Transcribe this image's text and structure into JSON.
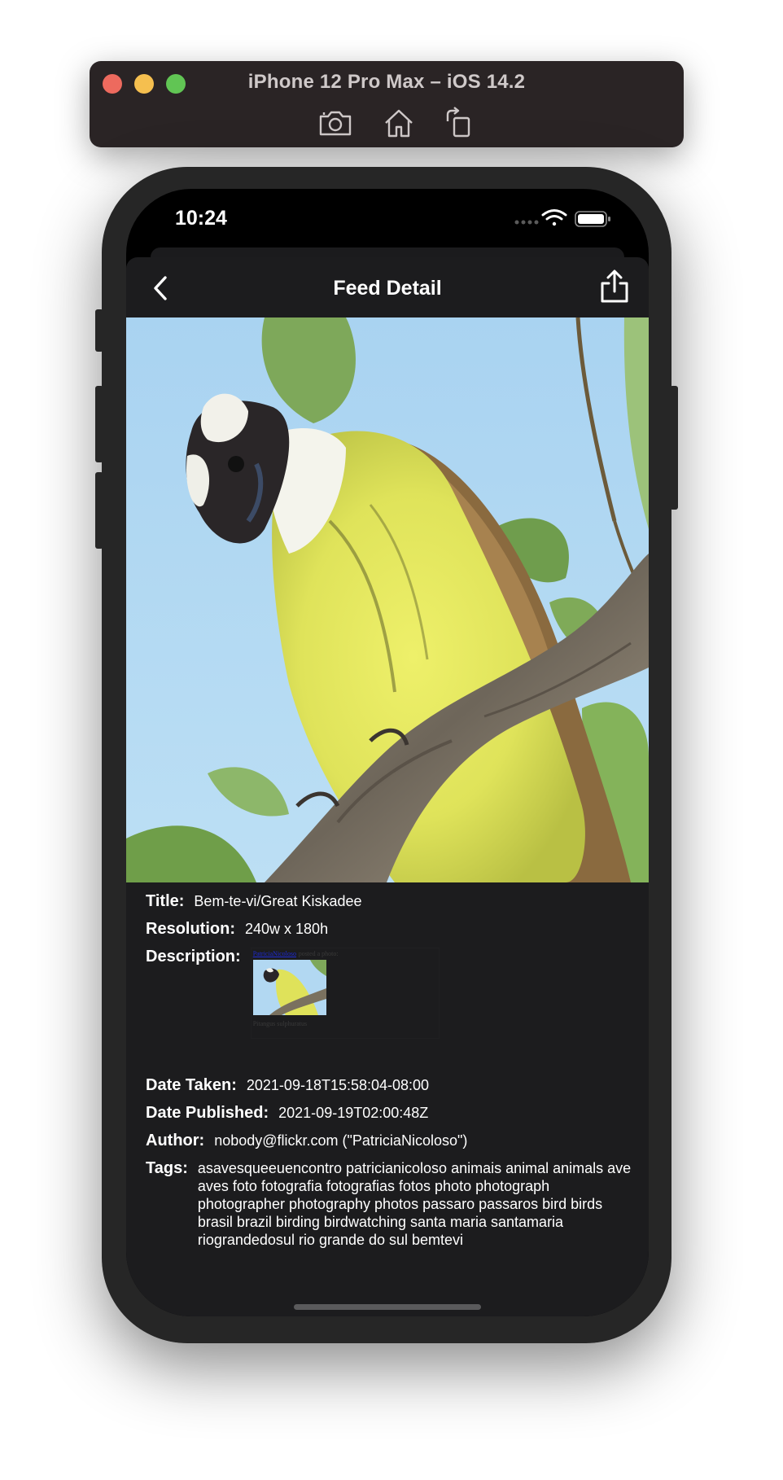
{
  "simulator": {
    "title": "iPhone 12 Pro Max – iOS 14.2",
    "tools": [
      "screenshot-icon",
      "home-icon",
      "rotate-icon"
    ]
  },
  "status_bar": {
    "time": "10:24"
  },
  "nav": {
    "title": "Feed Detail",
    "back_icon": "chevron-left-icon",
    "share_icon": "share-icon"
  },
  "details": {
    "title_label": "Title:",
    "title_value": "Bem-te-vi/Great Kiskadee",
    "resolution_label": "Resolution:",
    "resolution_value": "240w x 180h",
    "description_label": "Description:",
    "description_link": "PatriciaNicoloso",
    "description_posted": "posted a photo:",
    "description_caption": "Pitangus sulphuratus",
    "date_taken_label": "Date Taken:",
    "date_taken_value": "2021-09-18T15:58:04-08:00",
    "date_published_label": "Date Published:",
    "date_published_value": "2021-09-19T02:00:48Z",
    "author_label": "Author:",
    "author_value": "nobody@flickr.com (\"PatriciaNicoloso\")",
    "tags_label": "Tags:",
    "tags_value": "asavesqueeuencontro patricianicoloso animais animal animals ave aves foto fotografia fotografias fotos photo photograph photographer photography photos passaro passaros bird birds brasil brazil birding birdwatching santa maria santamaria riograndedosul rio grande do sul bemtevi"
  }
}
